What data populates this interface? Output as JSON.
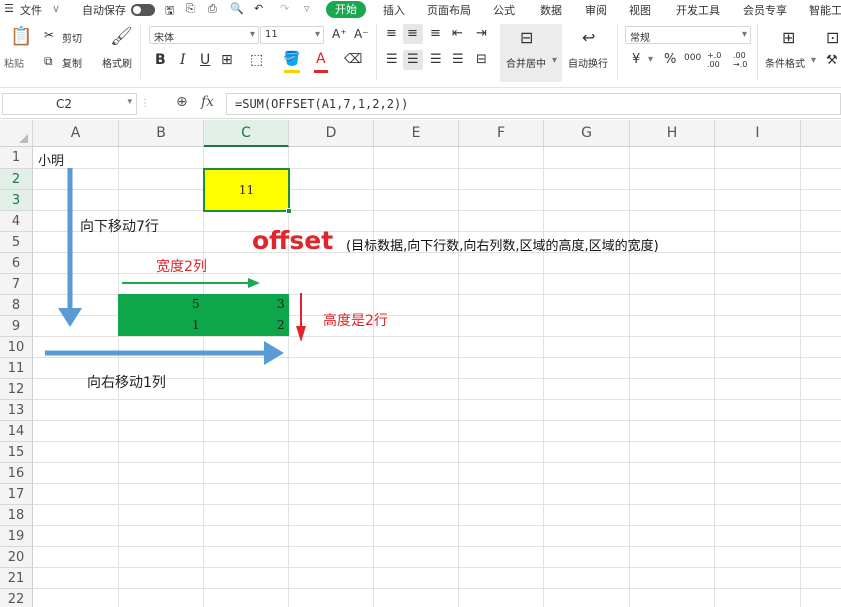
{
  "menubar": {
    "file": "文件",
    "autosave": "自动保存",
    "start": "开始",
    "tabs": [
      "插入",
      "页面布局",
      "公式",
      "数据",
      "审阅",
      "视图",
      "开发工具",
      "会员专享",
      "智能工"
    ]
  },
  "ribbon": {
    "paste": "粘贴",
    "cut": "剪切",
    "copy": "复制",
    "format_painter": "格式刷",
    "font_name": "宋体",
    "font_size": "11",
    "merge": "合并居中",
    "wrap": "自动换行",
    "number_format": "常规",
    "cond_format": "条件格式",
    "b": "B",
    "i": "I",
    "u": "U",
    "grow": "A⁺",
    "shrink": "A⁻",
    "currency": "¥",
    "percent": "%",
    "thousands": "000",
    "inc_dec": "+.0 .00",
    "dec_dec": ".00 →.0"
  },
  "formula_bar": {
    "name_box": "C2",
    "fx": "fx",
    "formula": "=SUM(OFFSET(A1,7,1,2,2))"
  },
  "columns": [
    "A",
    "B",
    "C",
    "D",
    "E",
    "F",
    "G",
    "H",
    "I"
  ],
  "rows": [
    "1",
    "2",
    "3",
    "4",
    "5",
    "6",
    "7",
    "8",
    "9",
    "10",
    "11",
    "12",
    "13",
    "14",
    "15",
    "16",
    "17",
    "18",
    "19",
    "20",
    "21",
    "22"
  ],
  "cells": {
    "a1": "小明",
    "c2": "11",
    "b8": "5",
    "c8": "3",
    "b9": "1",
    "c9": "2"
  },
  "annotations": {
    "move_down": "向下移动7行",
    "offset_big": "offset",
    "offset_desc": "(目标数据,向下行数,向右列数,区域的高度,区域的宽度)",
    "width": "宽度2列",
    "height": "高度是2行",
    "move_right": "向右移动1列"
  },
  "colors": {
    "accent_green": "#1aa750",
    "yellow_fill": "#ffff00",
    "green_fill": "#0ea64a",
    "arrow_blue": "#5b9bd5",
    "red": "#e0262a"
  }
}
